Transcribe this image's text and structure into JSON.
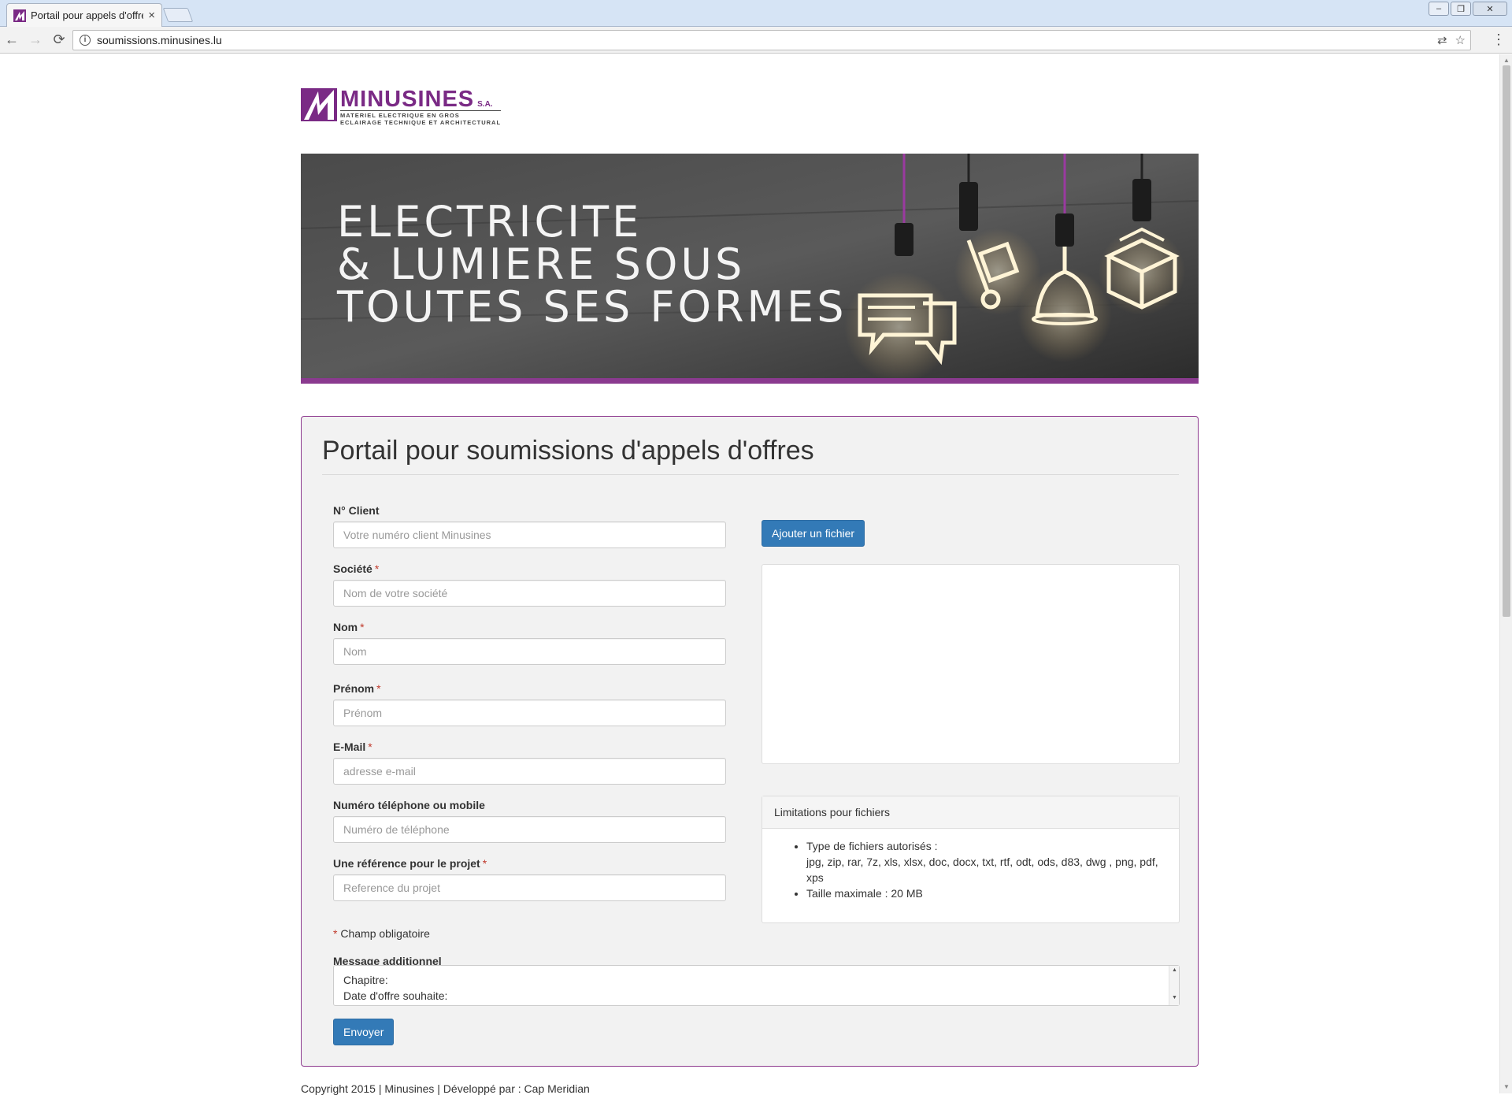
{
  "browser": {
    "tab_title": "Portail pour appels d'offres",
    "tab_close": "×",
    "url": "soumissions.minusines.lu",
    "back_icon": "←",
    "forward_icon": "→",
    "reload_icon": "⟳",
    "menu_icon": "⋮",
    "translate_icon": "⇄",
    "bookmark_icon": "☆",
    "win_minimize": "–",
    "win_maximize": "❐",
    "win_close": "✕"
  },
  "logo": {
    "name": "MINUSINES",
    "suffix": "S.A.",
    "line1": "MATERIEL ELECTRIQUE EN GROS",
    "line2": "ECLAIRAGE TECHNIQUE ET ARCHITECTURAL",
    "color": "#7a2a85"
  },
  "banner": {
    "line1": "ELECTRICITE",
    "line2": "& LUMIERE SOUS",
    "line3": "TOUTES SES FORMES",
    "stripe_color": "#8a3a8f"
  },
  "form": {
    "title": "Portail pour soumissions d'appels d'offres",
    "required_marker": "*",
    "fields": [
      {
        "label": "N° Client",
        "required": false,
        "placeholder": "Votre numéro client Minusines"
      },
      {
        "label": "Société",
        "required": true,
        "placeholder": "Nom de votre société"
      },
      {
        "label": "Nom",
        "required": true,
        "placeholder": "Nom"
      },
      {
        "label": "Prénom",
        "required": true,
        "placeholder": "Prénom"
      },
      {
        "label": "E-Mail",
        "required": true,
        "placeholder": "adresse e-mail"
      },
      {
        "label": "Numéro téléphone ou mobile",
        "required": false,
        "placeholder": "Numéro de téléphone"
      },
      {
        "label": "Une référence pour le projet",
        "required": true,
        "placeholder": "Reference du projet"
      }
    ],
    "required_note": "Champ obligatoire",
    "message_label": "Message additionnel",
    "message_value": "Chapitre:\nDate d'offre souhaite:\nRemarques:",
    "submit_label": "Envoyer",
    "add_file_label": "Ajouter un fichier",
    "limits": {
      "title": "Limitations pour fichiers",
      "types_label": "Type de fichiers autorisés :",
      "types_value": "jpg, zip, rar, 7z, xls, xlsx, doc, docx, txt, rtf, odt, ods, d83, dwg , png, pdf, xps",
      "max_size": "Taille maximale : 20 MB"
    },
    "accent_color": "#337ab7",
    "panel_border_color": "#8e3b8f",
    "required_color": "#c0392b"
  },
  "footer": {
    "text": "Copyright 2015 | Minusines | Développé par : Cap Meridian"
  }
}
